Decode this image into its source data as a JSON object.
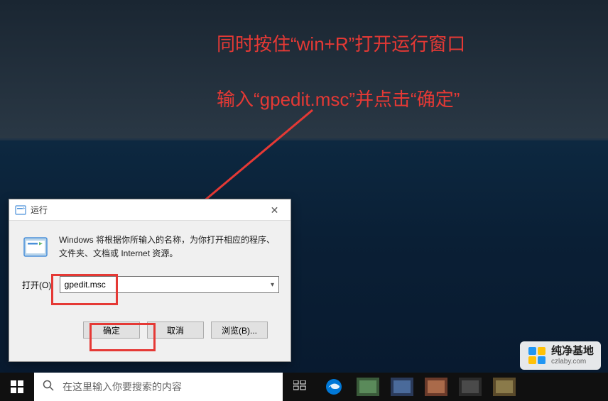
{
  "instructions": {
    "line1": "同时按住“win+R”打开运行窗口",
    "line2": "输入“gpedit.msc”并点击“确定”"
  },
  "run_dialog": {
    "title": "运行",
    "description": "Windows 将根据你所输入的名称，为你打开相应的程序、文件夹、文档或 Internet 资源。",
    "open_label": "打开(O):",
    "input_value": "gpedit.msc",
    "buttons": {
      "ok": "确定",
      "cancel": "取消",
      "browse": "浏览(B)..."
    }
  },
  "taskbar": {
    "search_placeholder": "在这里输入你要搜索的内容"
  },
  "watermark": {
    "cn": "纯净基地",
    "en": "czlaby.com"
  },
  "colors": {
    "annotation_red": "#e53935",
    "taskbar_bg": "#101010"
  }
}
